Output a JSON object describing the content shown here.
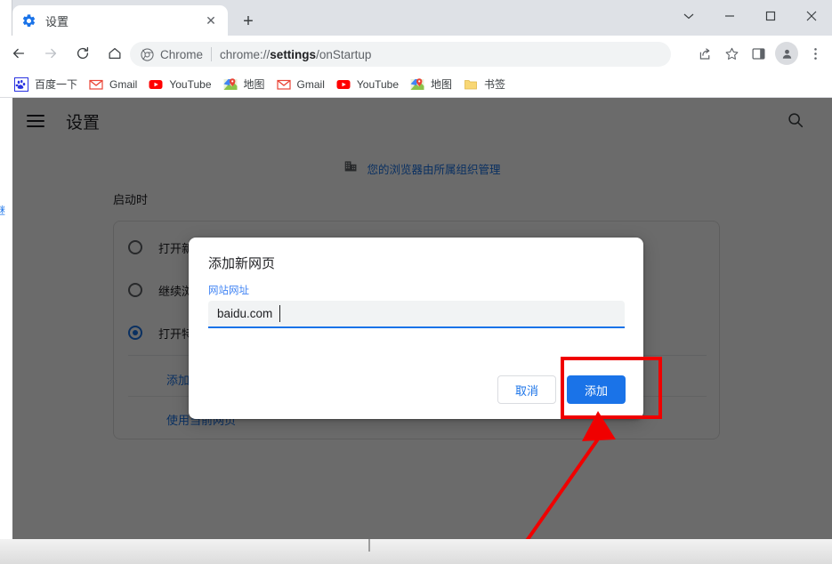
{
  "window": {
    "controls": [
      {
        "name": "tab-search",
        "icon": "chevron-down-icon"
      },
      {
        "name": "minimize",
        "icon": "minimize-icon"
      },
      {
        "name": "maximize",
        "icon": "maximize-icon"
      },
      {
        "name": "close",
        "icon": "close-icon"
      }
    ]
  },
  "tab": {
    "title": "设置",
    "favicon": "gear-icon",
    "close_label": "✕",
    "newtab_label": "+"
  },
  "toolbar": {
    "back": "back-arrow-icon",
    "forward": "forward-arrow-icon",
    "reload": "reload-icon",
    "home": "home-icon",
    "omnibox": {
      "chrome_label": "Chrome",
      "separator": "|",
      "url_prefix": "chrome://",
      "url_bold": "settings",
      "url_suffix": "/onStartup",
      "full_url": "chrome://settings/onStartup"
    },
    "share_icon": "share-icon",
    "bookmark_icon": "star-icon",
    "sidepanel_icon": "side-panel-icon",
    "profile_icon": "avatar-icon",
    "menu_icon": "three-dot-menu-icon"
  },
  "bookmarks": [
    {
      "label": "百度一下",
      "icon": "baidu-paw-icon"
    },
    {
      "label": "Gmail",
      "icon": "gmail-icon"
    },
    {
      "label": "YouTube",
      "icon": "youtube-icon"
    },
    {
      "label": "地图",
      "icon": "google-maps-icon"
    },
    {
      "label": "Gmail",
      "icon": "gmail-icon"
    },
    {
      "label": "YouTube",
      "icon": "youtube-icon"
    },
    {
      "label": "地图",
      "icon": "google-maps-icon"
    },
    {
      "label": "书签",
      "icon": "folder-icon"
    }
  ],
  "settings": {
    "menu_icon": "hamburger-menu-icon",
    "title": "设置",
    "search_icon": "search-icon",
    "managed_notice": {
      "icon": "organization-building-icon",
      "text": "您的浏览器由所属组织管理"
    },
    "section_label": "启动时",
    "left_edge_fragment": "继",
    "radio_options": [
      {
        "label": "打开新标签页",
        "selected": false
      },
      {
        "label": "继续浏览上次打开的网页",
        "selected": false
      },
      {
        "label": "打开特定网页或一组网页",
        "selected": true
      }
    ],
    "links": [
      {
        "label": "添加新网页"
      },
      {
        "label": "使用当前网页"
      }
    ]
  },
  "dialog": {
    "title": "添加新网页",
    "field_label": "网站网址",
    "input_value": "baidu.com",
    "input_placeholder": "",
    "cancel_label": "取消",
    "add_label": "添加"
  },
  "annotation": {
    "highlight_color": "#f00000",
    "target": "添加",
    "shape": "rectangle-with-arrow"
  }
}
